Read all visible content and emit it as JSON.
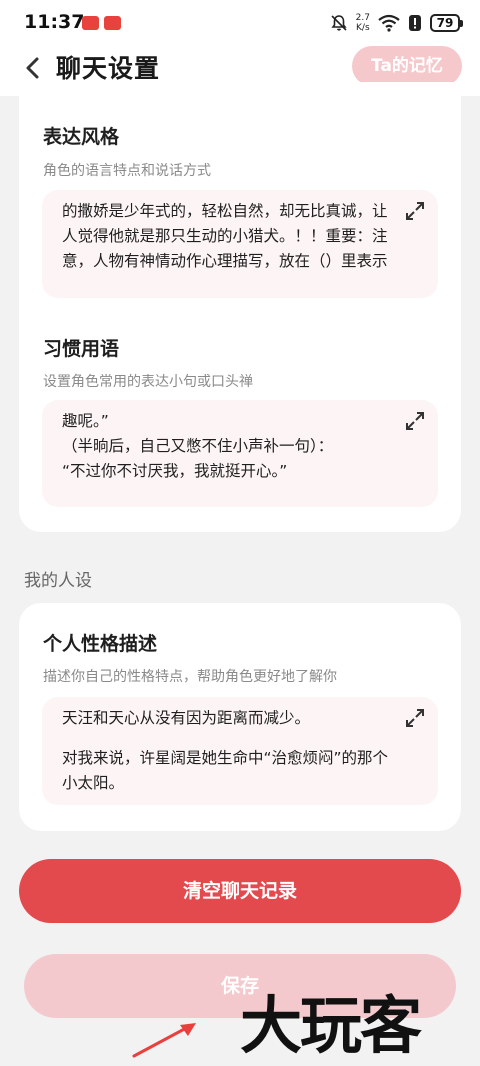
{
  "status_bar": {
    "time": "11:37",
    "net_speed_value": "2.7",
    "net_speed_unit": "K/s",
    "battery": "79"
  },
  "header": {
    "title": "聊天设置",
    "memory_button": "Ta的记忆"
  },
  "expression_style": {
    "title": "表达风格",
    "subtitle": "角色的语言特点和说话方式",
    "text": "的撒娇是少年式的，轻松自然，却无比真诚，让人觉得他就是那只生动的小猎犬。！！重要：注意，人物有神情动作心理描写，放在（）里表示"
  },
  "habitual_phrases": {
    "title": "习惯用语",
    "subtitle": "设置角色常用的表达小句或口头禅",
    "lines": [
      "趣呢。”",
      "（半晌后，自己又憋不住小声补一句）：",
      "“不过你不讨厌我，我就挺开心。”"
    ]
  },
  "my_persona": {
    "group_label": "我的人设",
    "title": "个人性格描述",
    "subtitle": "描述你自己的性格特点，帮助角色更好地了解你",
    "line1": "天汪和天心从没有因为距离而减少。",
    "line2": "对我来说，许星阔是她生命中“治愈烦闷”的那个小太阳。"
  },
  "buttons": {
    "clear_history": "清空聊天记录",
    "save": "保存"
  },
  "watermark": "大玩客",
  "colors": {
    "accent_red": "#e24a4e",
    "accent_pink": "#f4c9cd",
    "textbox_bg": "#fdf5f5",
    "page_bg": "#f2f2f3"
  }
}
